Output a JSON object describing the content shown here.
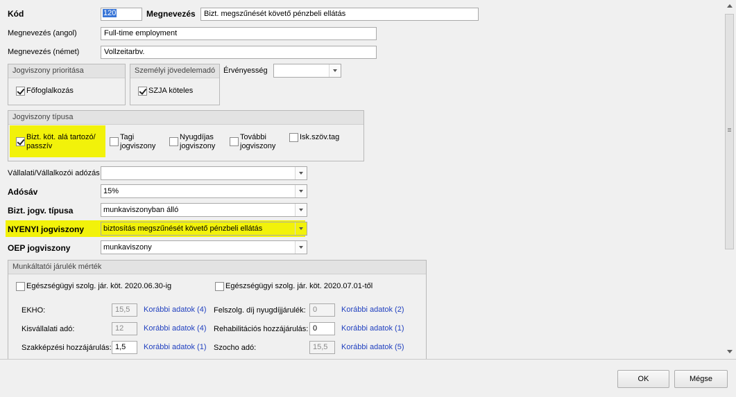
{
  "form": {
    "kod_label": "Kód",
    "kod_value": "120",
    "megnevezes_label": "Megnevezés",
    "megnevezes_value": "Bizt. megszűnését követő pénzbeli ellátás",
    "angol_label": "Megnevezés (angol)",
    "angol_value": "Full-time employment",
    "nemet_label": "Megnevezés (német)",
    "nemet_value": "Vollzeitarbv.",
    "prioritas_title": "Jogviszony prioritása",
    "fofoglalkozas": "Főfoglalkozás",
    "szja_title": "Személyi jövedelemadó",
    "szja_koteles": "SZJA köteles",
    "ervenyesseg_label": "Érvényesség",
    "ervenyesseg_value": "",
    "tipus_title": "Jogviszony típusa",
    "tipus_bizt_line1": "Bizt. köt. alá tartozó/",
    "tipus_bizt_line2": "passzív",
    "tipus_tagi_line1": "Tagi",
    "tipus_tagi_line2": "jogviszony",
    "tipus_nyugdijas_line1": "Nyugdíjas",
    "tipus_nyugdijas_line2": "jogviszony",
    "tipus_tovabbi_line1": "További",
    "tipus_tovabbi_line2": "jogviszony",
    "tipus_isk": "Isk.szöv.tag",
    "vallalati_label": "Vállalati/Vállalkozói adózás",
    "vallalati_value": "",
    "adosav_label": "Adósáv",
    "adosav_value": "15%",
    "bizt_tipusa_label": "Bizt. jogv. típusa",
    "bizt_tipusa_value": "munkaviszonyban álló",
    "nyenyi_label": "NYENYI jogviszony",
    "nyenyi_value": "biztosítás megszűnését követő pénzbeli ellátás",
    "oep_label": "OEP jogviszony",
    "oep_value": "munkaviszony"
  },
  "munkaltatoi": {
    "title": "Munkáltatói járulék mérték",
    "eg_before": "Egészségügyi szolg. jár. köt. 2020.06.30-ig",
    "eg_after": "Egészségügyi szolg. jár. köt. 2020.07.01-től",
    "ekho_label": "EKHO:",
    "ekho_value": "15,5",
    "ekho_link": "Korábbi adatok (4)",
    "kisv_label": "Kisvállalati adó:",
    "kisv_value": "12",
    "kisv_link": "Korábbi adatok (4)",
    "szakk_label": "Szakképzési hozzájárulás:",
    "szakk_value": "1,5",
    "szakk_link": "Korábbi adatok (1)",
    "felszolg_label": "Felszolg. díj nyugdíjjárulék:",
    "felszolg_value": "0",
    "felszolg_link": "Korábbi adatok (2)",
    "rehab_label": "Rehabilitációs hozzájárulás:",
    "rehab_value": "0",
    "rehab_link": "Korábbi adatok (1)",
    "szocho_label": "Szocho adó:",
    "szocho_value": "15,5",
    "szocho_link": "Korábbi adatok (5)"
  },
  "buttons": {
    "ok": "OK",
    "cancel": "Mégse"
  }
}
